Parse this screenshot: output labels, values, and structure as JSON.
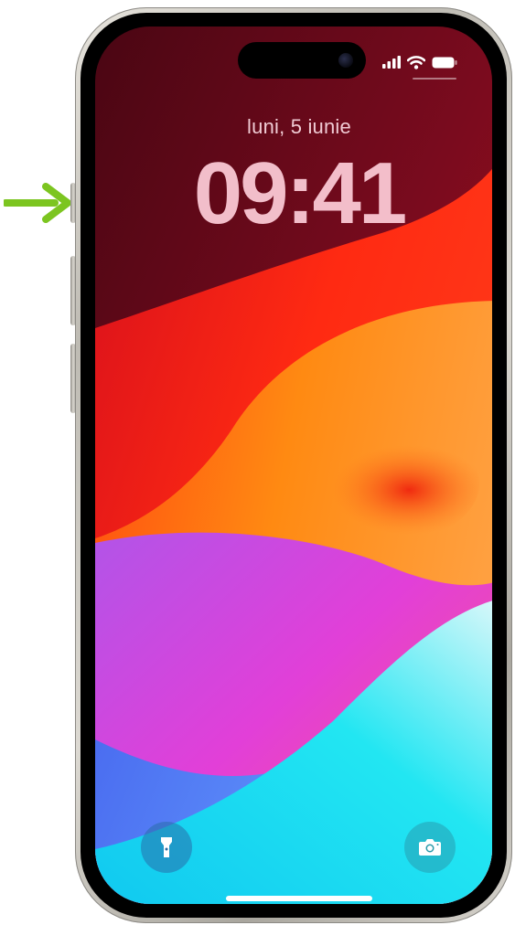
{
  "lock_screen": {
    "date": "luni, 5 iunie",
    "time": "09:41"
  },
  "status_bar": {
    "signal": "signal-bars-icon",
    "wifi": "wifi-icon",
    "battery": "battery-icon"
  },
  "quick_actions": {
    "flashlight": "flashlight-icon",
    "camera": "camera-icon"
  },
  "annotation": {
    "pointer": "arrow-right-icon",
    "color": "#7cc520"
  },
  "colors": {
    "frame": "#d6d3cc",
    "screen_top": "#6a0a18",
    "screen_red": "#f21d12",
    "screen_orange": "#ff8a10",
    "screen_magenta": "#d93bd8",
    "screen_cyan": "#18e4f2"
  }
}
